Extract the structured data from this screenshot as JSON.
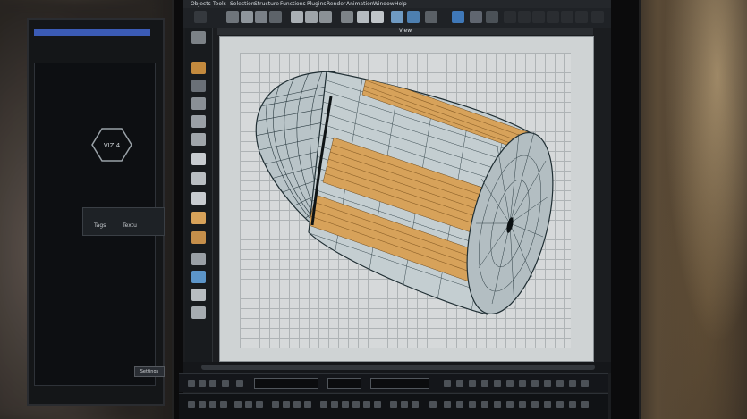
{
  "menu": {
    "items": [
      "Objects",
      "Tools",
      "Selection",
      "Structure",
      "Functions",
      "Plugins",
      "Render",
      "Animation",
      "Window",
      "Help"
    ]
  },
  "viewport": {
    "title": "View"
  },
  "side_monitor": {
    "badge": "VIZ 4",
    "panel_labels": [
      "Tags",
      "Textu"
    ],
    "button": "Settings"
  },
  "colors": {
    "wire": "#1f2e33",
    "shell": "#b8c4c8",
    "gold": "#d7a25a",
    "menu_text": "#d8dde2"
  }
}
